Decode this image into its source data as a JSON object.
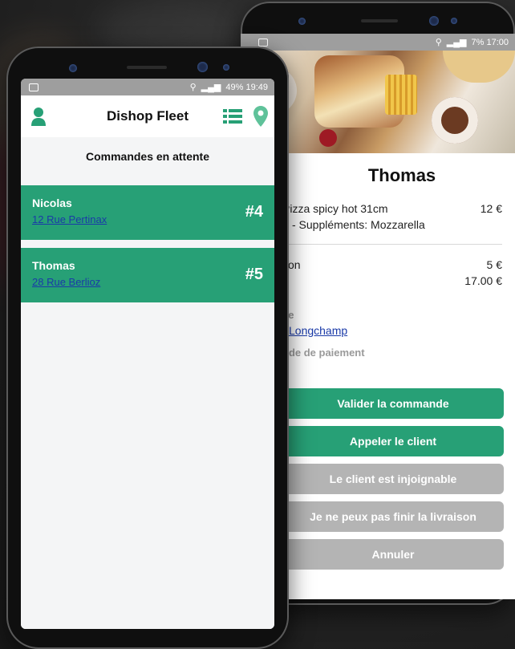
{
  "back_phone": {
    "status": {
      "right_text": "7% 17:00"
    },
    "customer_name": "Thomas",
    "items": [
      {
        "text": "Pizza spicy hot 31cm",
        "amount": "12 €"
      },
      {
        "text": "- Suppléments: Mozzarella",
        "amount": ""
      }
    ],
    "fee_label": "son",
    "fee_amount": "5 €",
    "total_amount": "17.00 €",
    "address_label": "se",
    "address_link": "Longchamp",
    "payment_label": "ode de paiement",
    "buttons": {
      "validate": "Valider la commande",
      "call": "Appeler le client",
      "unreachable": "Le client est injoignable",
      "cannot_finish": "Je ne peux pas finir la livraison",
      "cancel": "Annuler"
    },
    "colors": {
      "primary": "#27a076",
      "disabled": "#b4b4b4"
    }
  },
  "front_phone": {
    "status": {
      "right_text": "49% 19:49"
    },
    "app_title": "Dishop Fleet",
    "section_title": "Commandes en attente",
    "orders": [
      {
        "name": "Nicolas",
        "address": "12 Rue Pertinax",
        "number": "#4"
      },
      {
        "name": "Thomas",
        "address": "28 Rue Berlioz",
        "number": "#5"
      }
    ],
    "icons": [
      "user-icon",
      "list-icon",
      "map-pin-icon"
    ]
  }
}
